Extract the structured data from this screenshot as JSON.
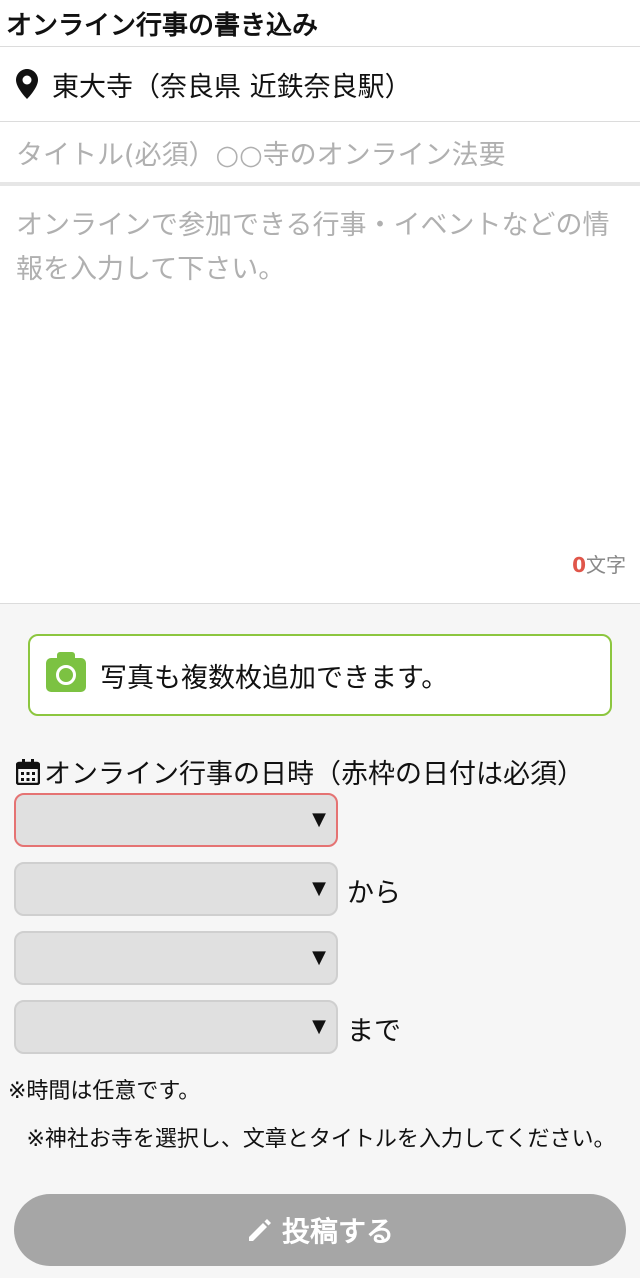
{
  "header": {
    "title": "オンライン行事の書き込み"
  },
  "location": {
    "icon": "map-pin-icon",
    "text": "東大寺（奈良県 近鉄奈良駅）"
  },
  "form": {
    "title_placeholder": "タイトル(必須）○○寺のオンライン法要",
    "body_placeholder": "オンラインで参加できる行事・イベントなどの情報を入力して下さい。",
    "char_count": "0",
    "char_unit": "文字"
  },
  "photo": {
    "icon": "camera-icon",
    "label": "写真も複数枚追加できます。"
  },
  "datetime": {
    "icon": "calendar-icon",
    "label": "オンライン行事の日時（赤枠の日付は必須）",
    "selects": [
      {
        "value": "",
        "arrow": "▼"
      },
      {
        "value": "",
        "arrow": "▼",
        "suffix": "から"
      },
      {
        "value": "",
        "arrow": "▼"
      },
      {
        "value": "",
        "arrow": "▼",
        "suffix": "まで"
      }
    ],
    "note_time": "※時間は任意です。"
  },
  "footer": {
    "instruction": "※神社お寺を選択し、文章とタイトルを入力してください。",
    "submit_label": "投稿する",
    "submit_icon": "pencil-icon"
  },
  "colors": {
    "accent_green": "#8cc63f",
    "required_red": "#e57373",
    "button_disabled": "#a6a6a6"
  }
}
